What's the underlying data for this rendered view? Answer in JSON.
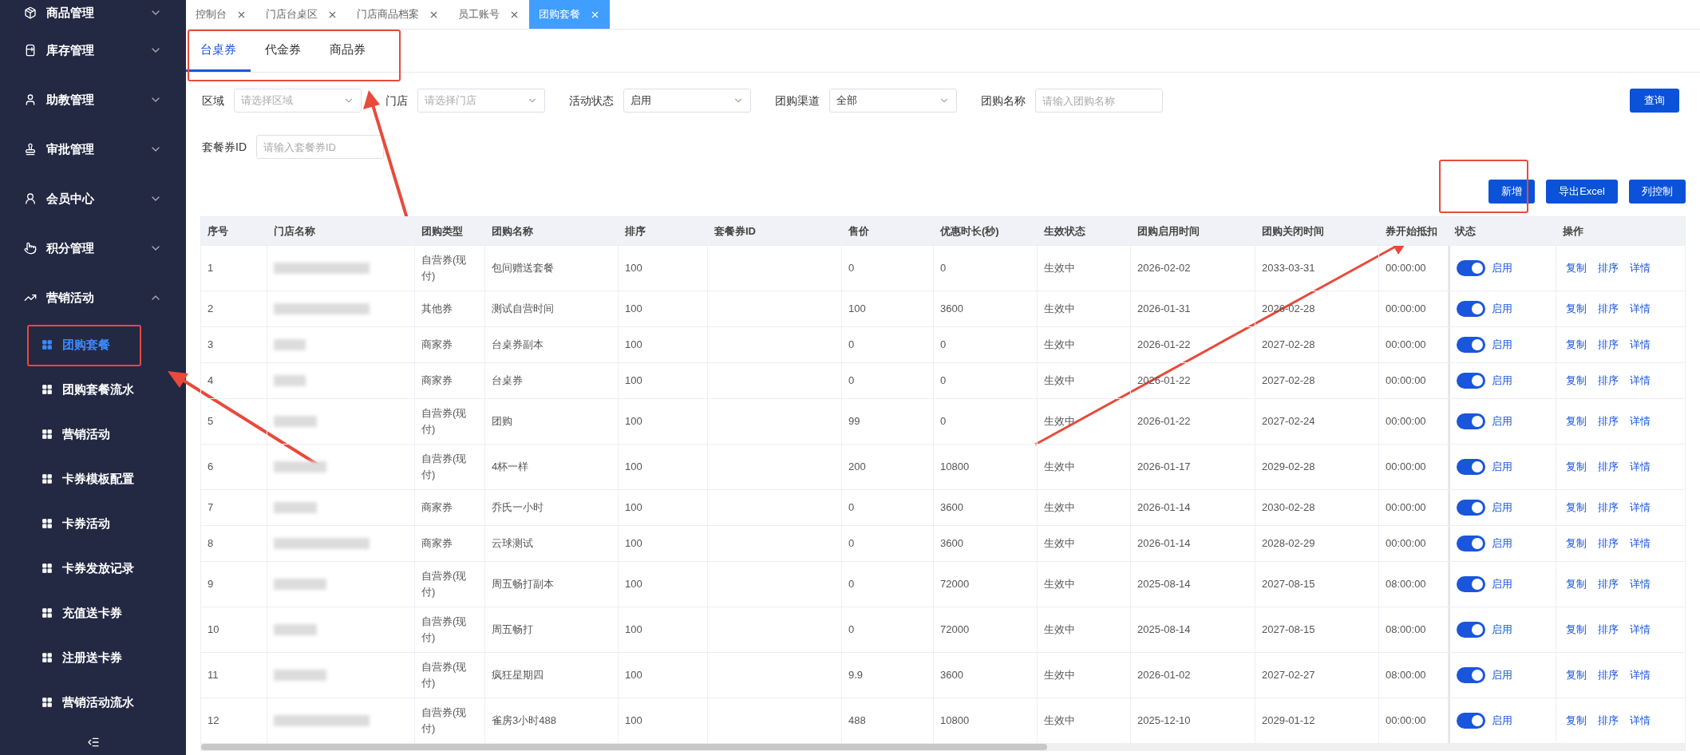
{
  "sidebar": {
    "items": [
      {
        "label": "商品管理",
        "expanded": false
      },
      {
        "label": "库存管理",
        "expanded": false
      },
      {
        "label": "助教管理",
        "expanded": false
      },
      {
        "label": "审批管理",
        "expanded": false
      },
      {
        "label": "会员中心",
        "expanded": false
      },
      {
        "label": "积分管理",
        "expanded": false
      },
      {
        "label": "营销活动",
        "expanded": true,
        "children": [
          {
            "label": "团购套餐",
            "selected": true
          },
          {
            "label": "团购套餐流水",
            "selected": false
          },
          {
            "label": "营销活动",
            "selected": false
          },
          {
            "label": "卡券模板配置",
            "selected": false
          },
          {
            "label": "卡券活动",
            "selected": false
          },
          {
            "label": "卡券发放记录",
            "selected": false
          },
          {
            "label": "充值送卡券",
            "selected": false
          },
          {
            "label": "注册送卡券",
            "selected": false
          },
          {
            "label": "营销活动流水",
            "selected": false
          }
        ]
      }
    ]
  },
  "tabs": [
    {
      "label": "控制台",
      "selected": false
    },
    {
      "label": "门店台桌区",
      "selected": false
    },
    {
      "label": "门店商品档案",
      "selected": false
    },
    {
      "label": "员工账号",
      "selected": false
    },
    {
      "label": "团购套餐",
      "selected": true
    }
  ],
  "sub_tabs": [
    {
      "label": "台桌券",
      "selected": true
    },
    {
      "label": "代金券",
      "selected": false
    },
    {
      "label": "商品券",
      "selected": false
    }
  ],
  "filters": [
    {
      "kind": "select",
      "label": "区域",
      "placeholder": "请选择区域"
    },
    {
      "kind": "select",
      "label": "门店",
      "placeholder": "请选择门店"
    },
    {
      "kind": "select",
      "label": "活动状态",
      "value": "启用"
    },
    {
      "kind": "select",
      "label": "团购渠道",
      "value": "全部"
    },
    {
      "kind": "input",
      "label": "团购名称",
      "placeholder": "请输入团购名称"
    },
    {
      "kind": "input",
      "label": "套餐券ID",
      "placeholder": "请输入套餐券ID"
    }
  ],
  "query_button": "查询",
  "actions": [
    "新增",
    "导出Excel",
    "列控制"
  ],
  "table": {
    "columns": [
      "序号",
      "门店名称",
      "团购类型",
      "团购名称",
      "排序",
      "套餐券ID",
      "售价",
      "优惠时长(秒)",
      "生效状态",
      "团购启用时间",
      "团购关闭时间",
      "券开始抵扣",
      "状态",
      "操作"
    ],
    "rows": [
      {
        "no": "1",
        "type": "自营券(现付)",
        "name": "包间赠送套餐",
        "sort": "100",
        "price": "0",
        "duration": "0",
        "effect": "生效中",
        "start": "2026-02-02",
        "end": "2033-03-31",
        "deduct": "00:00:00",
        "status": {
          "on": true,
          "label": "启用"
        },
        "ops": [
          "复制",
          "排序",
          "详情"
        ]
      },
      {
        "no": "2",
        "type": "其他券",
        "name": "测试自营时间",
        "sort": "100",
        "price": "100",
        "duration": "3600",
        "effect": "生效中",
        "start": "2026-01-31",
        "end": "2026-02-28",
        "deduct": "00:00:00",
        "status": {
          "on": true,
          "label": "启用"
        },
        "ops": [
          "复制",
          "排序",
          "详情"
        ]
      },
      {
        "no": "3",
        "type": "商家券",
        "name": "台桌券副本",
        "sort": "100",
        "price": "0",
        "duration": "0",
        "effect": "生效中",
        "start": "2026-01-22",
        "end": "2027-02-28",
        "deduct": "00:00:00",
        "status": {
          "on": true,
          "label": "启用"
        },
        "ops": [
          "复制",
          "排序",
          "详情"
        ]
      },
      {
        "no": "4",
        "type": "商家券",
        "name": "台桌券",
        "sort": "100",
        "price": "0",
        "duration": "0",
        "effect": "生效中",
        "start": "2026-01-22",
        "end": "2027-02-28",
        "deduct": "00:00:00",
        "status": {
          "on": true,
          "label": "启用"
        },
        "ops": [
          "复制",
          "排序",
          "详情"
        ]
      },
      {
        "no": "5",
        "type": "自营券(现付)",
        "name": "团购",
        "sort": "100",
        "price": "99",
        "duration": "0",
        "effect": "生效中",
        "start": "2026-01-22",
        "end": "2027-02-24",
        "deduct": "00:00:00",
        "status": {
          "on": true,
          "label": "启用"
        },
        "ops": [
          "复制",
          "排序",
          "详情"
        ]
      },
      {
        "no": "6",
        "type": "自营券(现付)",
        "name": "4杯一样",
        "sort": "100",
        "price": "200",
        "duration": "10800",
        "effect": "生效中",
        "start": "2026-01-17",
        "end": "2029-02-28",
        "deduct": "00:00:00",
        "status": {
          "on": true,
          "label": "启用"
        },
        "ops": [
          "复制",
          "排序",
          "详情"
        ]
      },
      {
        "no": "7",
        "type": "商家券",
        "name": "乔氏一小时",
        "sort": "100",
        "price": "0",
        "duration": "3600",
        "effect": "生效中",
        "start": "2026-01-14",
        "end": "2030-02-28",
        "deduct": "00:00:00",
        "status": {
          "on": true,
          "label": "启用"
        },
        "ops": [
          "复制",
          "排序",
          "详情"
        ]
      },
      {
        "no": "8",
        "type": "商家券",
        "name": "云球测试",
        "sort": "100",
        "price": "0",
        "duration": "3600",
        "effect": "生效中",
        "start": "2026-01-14",
        "end": "2028-02-29",
        "deduct": "00:00:00",
        "status": {
          "on": true,
          "label": "启用"
        },
        "ops": [
          "复制",
          "排序",
          "详情"
        ]
      },
      {
        "no": "9",
        "type": "自营券(现付)",
        "name": "周五畅打副本",
        "sort": "100",
        "price": "0",
        "duration": "72000",
        "effect": "生效中",
        "start": "2025-08-14",
        "end": "2027-08-15",
        "deduct": "08:00:00",
        "status": {
          "on": true,
          "label": "启用"
        },
        "ops": [
          "复制",
          "排序",
          "详情"
        ]
      },
      {
        "no": "10",
        "type": "自营券(现付)",
        "name": "周五畅打",
        "sort": "100",
        "price": "0",
        "duration": "72000",
        "effect": "生效中",
        "start": "2025-08-14",
        "end": "2027-08-15",
        "deduct": "08:00:00",
        "status": {
          "on": true,
          "label": "启用"
        },
        "ops": [
          "复制",
          "排序",
          "详情"
        ]
      },
      {
        "no": "11",
        "type": "自营券(现付)",
        "name": "疯狂星期四",
        "sort": "100",
        "price": "9.9",
        "duration": "3600",
        "effect": "生效中",
        "start": "2026-01-02",
        "end": "2027-02-27",
        "deduct": "08:00:00",
        "status": {
          "on": true,
          "label": "启用"
        },
        "ops": [
          "复制",
          "排序",
          "详情"
        ]
      },
      {
        "no": "12",
        "type": "自营券(现付)",
        "name": "雀房3小时488",
        "sort": "100",
        "price": "488",
        "duration": "10800",
        "effect": "生效中",
        "start": "2025-12-10",
        "end": "2029-01-12",
        "deduct": "00:00:00",
        "status": {
          "on": true,
          "label": "启用"
        },
        "ops": [
          "复制",
          "排序",
          "详情"
        ]
      }
    ]
  }
}
